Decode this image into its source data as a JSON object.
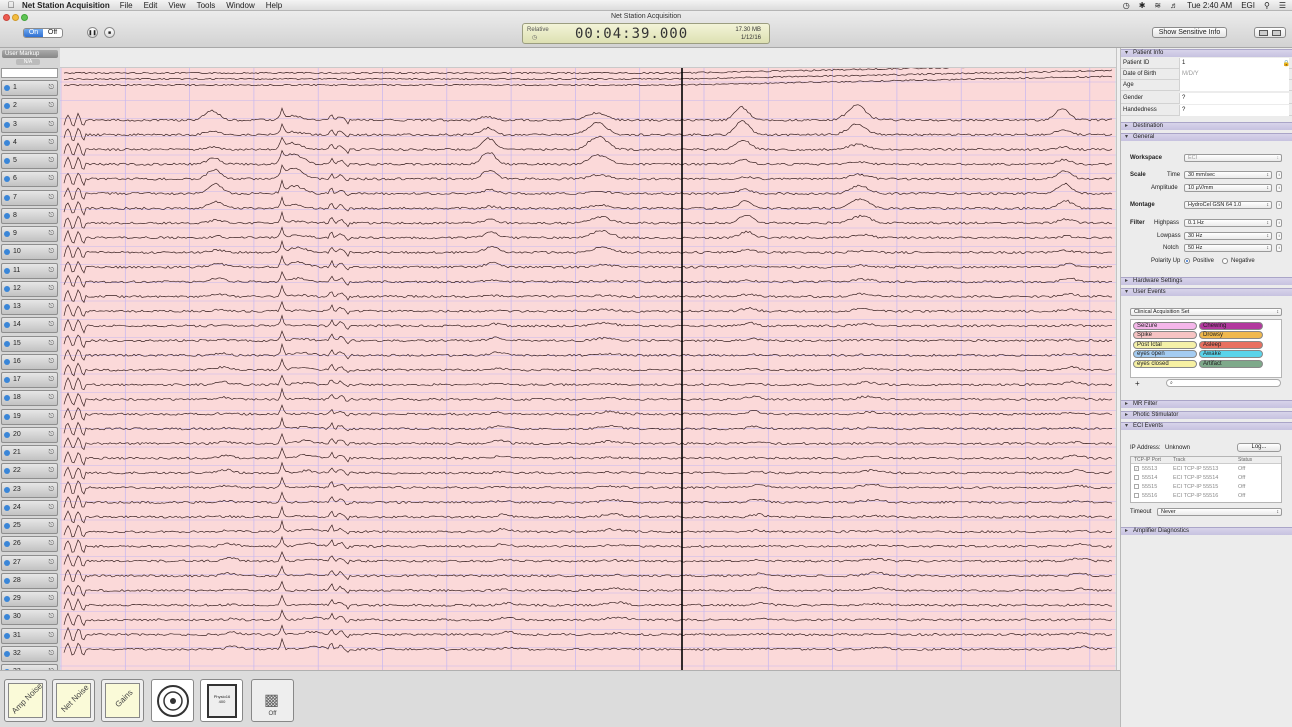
{
  "menubar": {
    "app_name": "Net Station Acquisition",
    "items": [
      "File",
      "Edit",
      "View",
      "Tools",
      "Window",
      "Help"
    ],
    "status_right": {
      "bt": "✱",
      "clock": "Tue 2:40 AM",
      "user": "EGI"
    }
  },
  "window": {
    "title": "Net Station Acquisition"
  },
  "toolbar": {
    "on_label": "On",
    "off_label": "Off",
    "pause_glyph": "❚❚",
    "stop_glyph": "■",
    "lcd": {
      "relative_label": "Relative",
      "timer": "00:04:39.000",
      "size": "17.30 MB",
      "date": "1/12/16"
    },
    "sensitive_button": "Show Sensitive Info"
  },
  "channels": {
    "user_markup_label": "User Markup",
    "user_markup_sub": "N/A",
    "labels": [
      "1",
      "2",
      "3",
      "4",
      "5",
      "6",
      "7",
      "8",
      "9",
      "10",
      "11",
      "12",
      "13",
      "14",
      "15",
      "16",
      "17",
      "18",
      "19",
      "20",
      "21",
      "22",
      "23",
      "24",
      "25",
      "26",
      "27",
      "28",
      "29",
      "30",
      "31",
      "32",
      "33"
    ]
  },
  "sidebar": {
    "patient_info": {
      "header": "Patient Info",
      "fields": [
        {
          "label": "Patient ID",
          "value": "1"
        },
        {
          "label": "Date of Birth",
          "value": "M/D/Y"
        },
        {
          "label": "Age",
          "value": ""
        },
        {
          "label": "Gender",
          "value": "?"
        },
        {
          "label": "Handedness",
          "value": "?"
        }
      ]
    },
    "destination_header": "Destination",
    "general": {
      "header": "General",
      "workspace_label": "Workspace",
      "workspace_value": "ECI",
      "scale_label": "Scale",
      "time_label": "Time",
      "time_value": "30 mm/sec",
      "amplitude_label": "Amplitude",
      "amplitude_value": "10 µV/mm",
      "montage_label": "Montage",
      "montage_value": "HydroCel GSN 64 1.0",
      "filter_label": "Filter",
      "highpass_label": "Highpass",
      "highpass_value": "0.1 Hz",
      "lowpass_label": "Lowpass",
      "lowpass_value": "30 Hz",
      "notch_label": "Notch",
      "notch_value": "50 Hz",
      "polarity_label": "Polarity Up",
      "positive_label": "Positive",
      "negative_label": "Negative"
    },
    "hardware_header": "Hardware Settings",
    "user_events": {
      "header": "User Events",
      "set_value": "Clinical Acquisition Set",
      "tags": [
        {
          "label": "Seizure",
          "color": "#f4b6ea"
        },
        {
          "label": "Chewing",
          "color": "#b2399e"
        },
        {
          "label": "Spike",
          "color": "#f6c3c3"
        },
        {
          "label": "Drowsy",
          "color": "#f0b84d"
        },
        {
          "label": "Post Ictal",
          "color": "#f4f0a8"
        },
        {
          "label": "Asleep",
          "color": "#e87060"
        },
        {
          "label": "eyes open",
          "color": "#a4ccf2"
        },
        {
          "label": "Awake",
          "color": "#5ad4ea"
        },
        {
          "label": "eyes closed",
          "color": "#f6f0a2"
        },
        {
          "label": "Artifact",
          "color": "#7ea98a"
        }
      ],
      "add_glyph": "+",
      "search_glyph": "⌕"
    },
    "mr_filter_header": "MR Filter",
    "photic_header": "Photic Stimulator",
    "eci_events": {
      "header": "ECI Events",
      "ip_label": "IP Address:",
      "ip_value": "Unknown",
      "log_button": "Log...",
      "columns": [
        "TCP-IP Port",
        "Track",
        "Status"
      ],
      "rows": [
        {
          "port": "55513",
          "track": "ECI TCP-IP 55513",
          "status": "Off"
        },
        {
          "port": "55514",
          "track": "ECI TCP-IP 55514",
          "status": "Off"
        },
        {
          "port": "55515",
          "track": "ECI TCP-IP 55515",
          "status": "Off"
        },
        {
          "port": "55516",
          "track": "ECI TCP-IP 55516",
          "status": "Off"
        }
      ],
      "timeout_label": "Timeout",
      "timeout_value": "Never"
    },
    "amp_diag_header": "Amplifier Diagnostics"
  },
  "tray": {
    "amp_noise": "Amp Noise",
    "net_noise": "Net Noise",
    "gains": "Gains",
    "photic": "Physio16\n400",
    "video": "Off"
  },
  "colors": {
    "eeg_bg": "#fbd9d9",
    "grid": "#c6b6f0",
    "trace": "#3a2222",
    "cursor": "#000000"
  }
}
